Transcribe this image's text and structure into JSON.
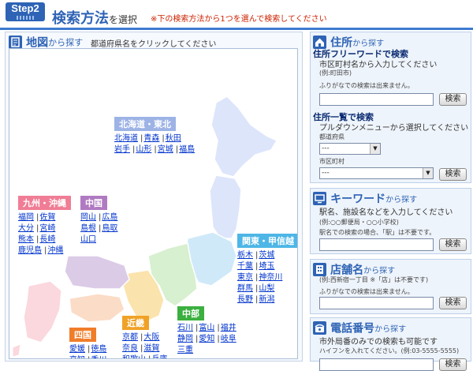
{
  "header": {
    "step": "Step2",
    "title": "検索方法",
    "title_suffix": "を選択",
    "note": "※下の検索方法から1つを選んで検索してください"
  },
  "map": {
    "title": "地図",
    "title_suffix": "から探す",
    "hint": "都道府県名をクリックしてください",
    "regions": [
      {
        "id": "hokkaido-tohoku",
        "name": "北海道・東北",
        "color": "#9db3e6",
        "rows": [
          [
            "北海道",
            "青森",
            "秋田"
          ],
          [
            "岩手",
            "山形",
            "宮城",
            "福島"
          ]
        ]
      },
      {
        "id": "kyushu-okinawa",
        "name": "九州・沖縄",
        "color": "#f07d95",
        "rows": [
          [
            "福岡",
            "佐賀"
          ],
          [
            "大分",
            "宮崎"
          ],
          [
            "熊本",
            "長崎"
          ],
          [
            "鹿児島",
            "沖縄"
          ]
        ]
      },
      {
        "id": "chugoku",
        "name": "中国",
        "color": "#b07ac2",
        "rows": [
          [
            "岡山",
            "広島"
          ],
          [
            "島根",
            "鳥取"
          ],
          [
            "山口"
          ]
        ]
      },
      {
        "id": "kanto-koshinetsu",
        "name": "関東・甲信越",
        "color": "#4eb6e6",
        "rows": [
          [
            "栃木",
            "茨城"
          ],
          [
            "千葉",
            "埼玉"
          ],
          [
            "東京",
            "神奈川"
          ],
          [
            "群馬",
            "山梨"
          ],
          [
            "長野",
            "新潟"
          ]
        ]
      },
      {
        "id": "chubu",
        "name": "中部",
        "color": "#3bb03f",
        "rows": [
          [
            "石川",
            "富山",
            "福井"
          ],
          [
            "静岡",
            "愛知",
            "岐阜"
          ],
          [
            "三重"
          ]
        ]
      },
      {
        "id": "kinki",
        "name": "近畿",
        "color": "#f0a227",
        "rows": [
          [
            "京都",
            "大阪"
          ],
          [
            "奈良",
            "滋賀"
          ],
          [
            "和歌山",
            "兵庫"
          ]
        ]
      },
      {
        "id": "shikoku",
        "name": "四国",
        "color": "#f07d2a",
        "rows": [
          [
            "愛媛",
            "徳島"
          ],
          [
            "高知",
            "香川"
          ]
        ]
      }
    ]
  },
  "address": {
    "title": "住所",
    "title_suffix": "から探す",
    "free_title": "住所フリーワードで検索",
    "free_desc": "市区町村名から入力してください",
    "free_example": "(例:町田市)",
    "free_note": "ふりがなでの検索は出来ません。",
    "free_button": "検索",
    "list_title": "住所一覧で検索",
    "list_desc": "プルダウンメニューから選択してください",
    "pref_label": "都道府県",
    "pref_value": "---",
    "city_label": "市区町村",
    "city_value": "---",
    "list_button": "検索"
  },
  "keyword": {
    "title": "キーワード",
    "title_suffix": "から探す",
    "desc": "駅名、施設名などを入力してください",
    "example": "(例:○○郵便局・○○小学校)",
    "note": "駅名での検索の場合、「駅」は不要です。",
    "button": "検索"
  },
  "shopname": {
    "title": "店舗名",
    "title_suffix": "から探す",
    "example": "(例:西新宿一丁目 ※「店」は不要です)",
    "note": "ふりがなでの検索は出来ません。",
    "button": "検索"
  },
  "phone": {
    "title": "電話番号",
    "title_suffix": "から探す",
    "desc": "市外局番のみでの検索も可能です",
    "note": "ハイフンを入れてください。(例:03-5555-5555)",
    "button": "検索"
  },
  "colors": {
    "brand": "#2e63b5",
    "note_red": "#cc2200",
    "link": "#0033cc"
  }
}
